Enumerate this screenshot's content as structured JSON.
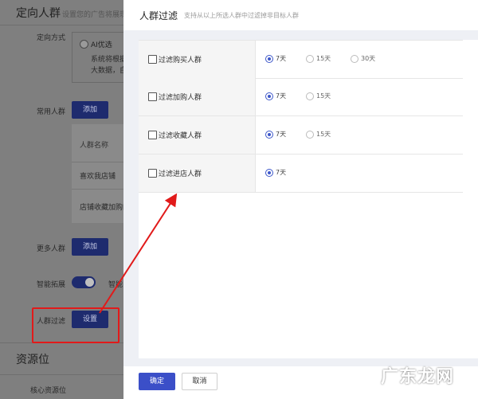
{
  "background": {
    "section_title": "定向人群",
    "section_hint": "设置您的广告将展现",
    "targeting_mode_label": "定向方式",
    "ai_option": "AI优选",
    "ai_desc_line1": "系统将根据",
    "ai_desc_line2": "大数据，自",
    "common_crowd_label": "常用人群",
    "add_button": "添加",
    "table_header": "人群名称",
    "row1": "喜欢我店铺",
    "row2": "店铺收藏加购的",
    "more_crowd_label": "更多人群",
    "add_button2": "添加",
    "smart_expand_label": "智能拓展",
    "smart_expand_value": "智能",
    "crowd_filter_label": "人群过滤",
    "set_button": "设置",
    "resource_title": "资源位",
    "core_resource_label": "核心资源位"
  },
  "drawer": {
    "title": "人群过滤",
    "subtitle": "支持从以上所选人群中过滤掉非目标人群",
    "rows": [
      {
        "label": "过滤购买人群",
        "options": [
          {
            "label": "7天",
            "selected": true
          },
          {
            "label": "15天",
            "selected": false
          },
          {
            "label": "30天",
            "selected": false
          }
        ]
      },
      {
        "label": "过滤加购人群",
        "options": [
          {
            "label": "7天",
            "selected": true
          },
          {
            "label": "15天",
            "selected": false
          }
        ]
      },
      {
        "label": "过滤收藏人群",
        "options": [
          {
            "label": "7天",
            "selected": true
          },
          {
            "label": "15天",
            "selected": false
          }
        ]
      },
      {
        "label": "过滤进店人群",
        "options": [
          {
            "label": "7天",
            "selected": true
          }
        ]
      }
    ],
    "confirm_label": "确定",
    "cancel_label": "取消"
  },
  "watermark": "广东龙网",
  "colors": {
    "accent": "#3b4fc8",
    "annotation": "#e11a1a"
  }
}
